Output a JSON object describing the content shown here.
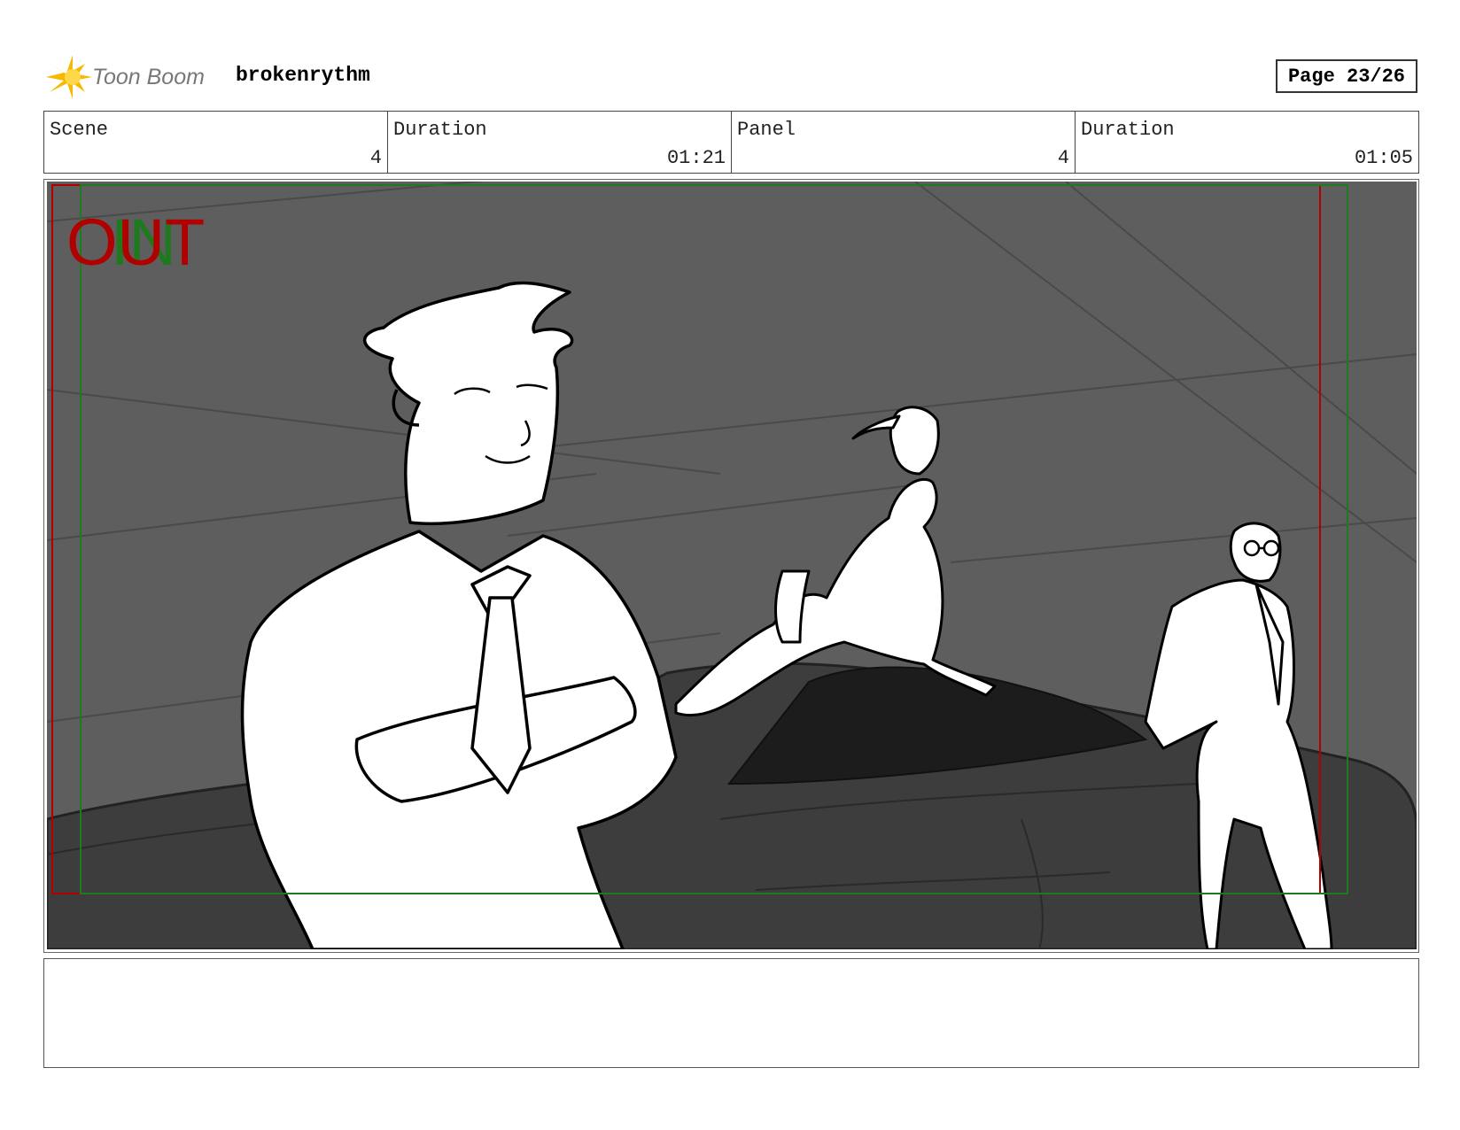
{
  "header": {
    "app_name": "Toon Boom",
    "project_name": "brokenrythm",
    "page_indicator": "Page 23/26"
  },
  "info": {
    "scene_label": "Scene",
    "scene_value": "4",
    "scene_duration_label": "Duration",
    "scene_duration_value": "01:21",
    "panel_label": "Panel",
    "panel_value": "4",
    "panel_duration_label": "Duration",
    "panel_duration_value": "01:05"
  },
  "panel": {
    "out_label": "OUT",
    "in_label": "IN",
    "colors": {
      "background": "#5e5e5e",
      "car": "#3d3d3d",
      "out_frame": "#b00000",
      "in_frame": "#1f7a1f"
    }
  },
  "notes": {
    "text": ""
  }
}
